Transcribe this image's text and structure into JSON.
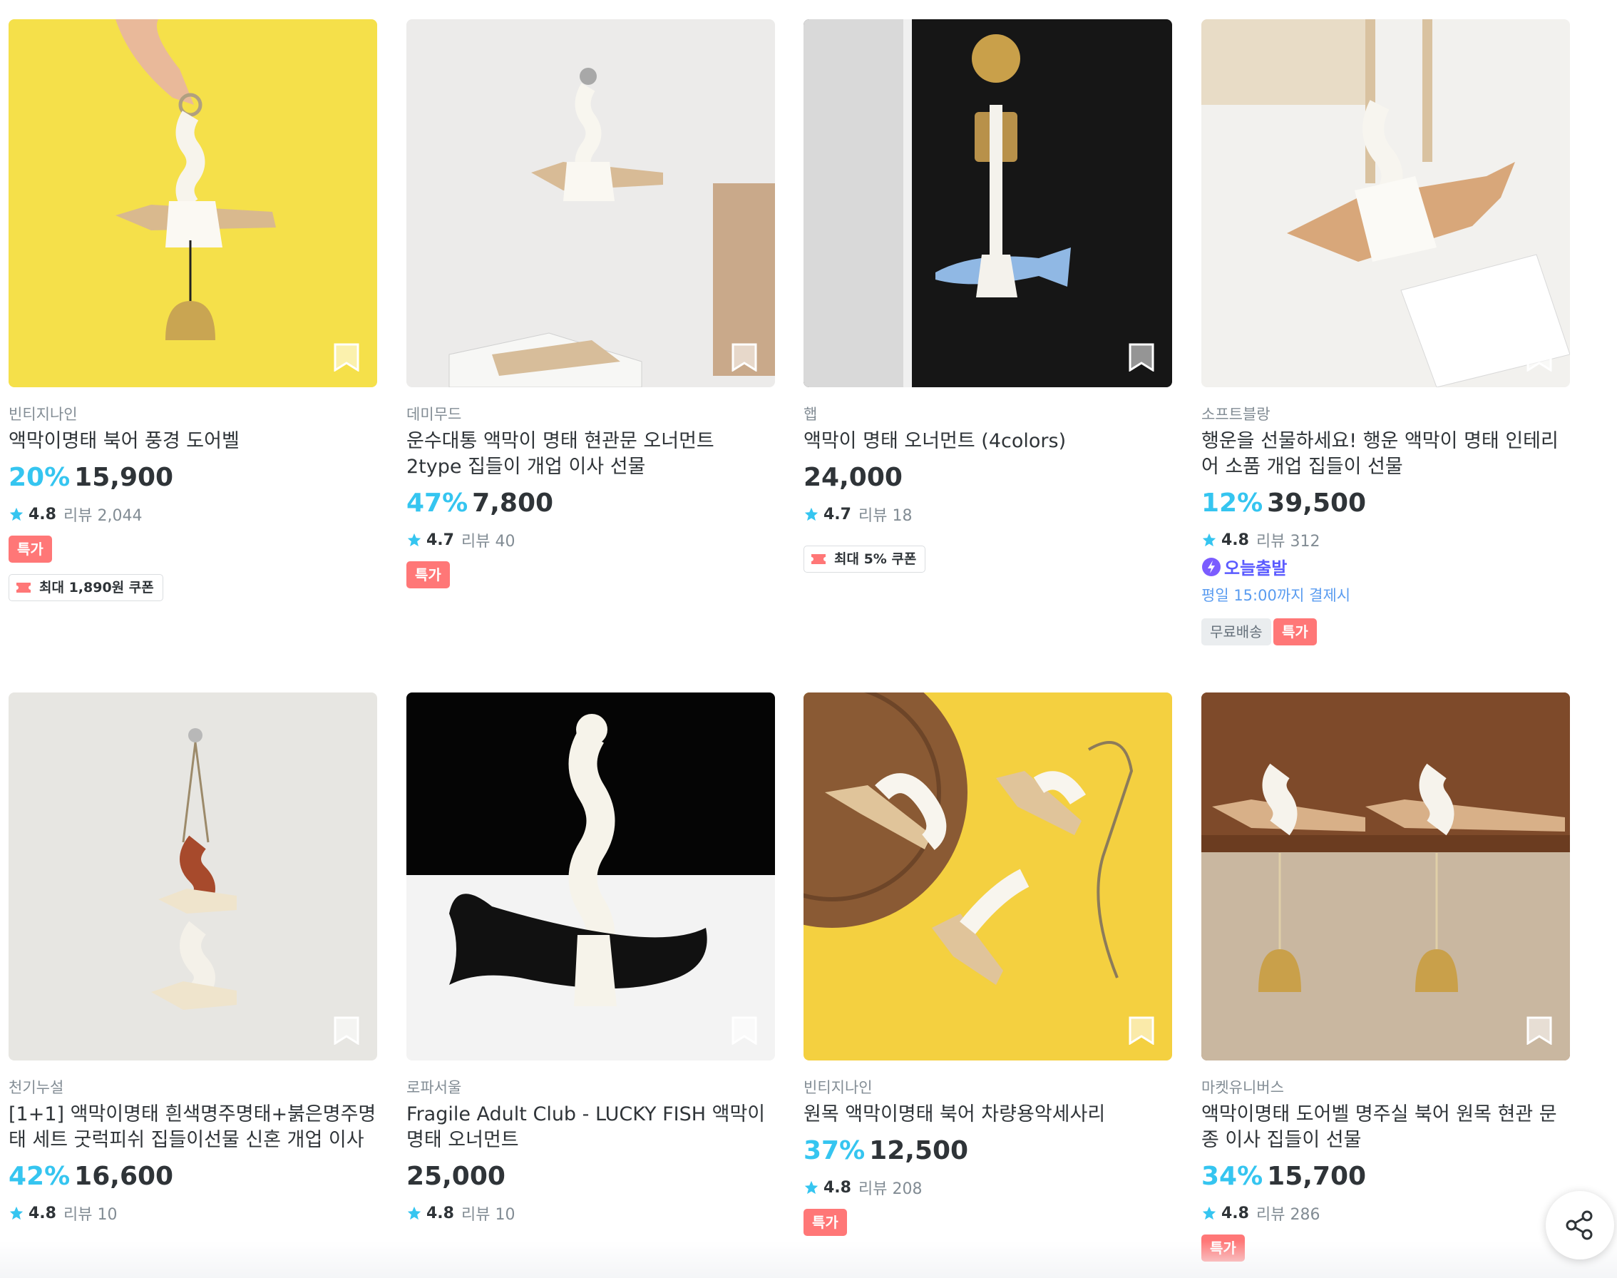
{
  "products": [
    {
      "brand": "빈티지나인",
      "title": "액막이명태 북어 풍경 도어벨",
      "discount": "20%",
      "price": "15,900",
      "rating": "4.8",
      "reviews": "리뷰 2,044",
      "badges": [
        "특가"
      ],
      "coupon": "최대 1,890원 쿠폰"
    },
    {
      "brand": "데미무드",
      "title": "운수대통 액막이 명태 현관문 오너먼트 2type 집들이 개업 이사 선물",
      "discount": "47%",
      "price": "7,800",
      "rating": "4.7",
      "reviews": "리뷰 40",
      "badges": [
        "특가"
      ]
    },
    {
      "brand": "햅",
      "title": "액막이 명태 오너먼트 (4colors)",
      "discount": "",
      "price": "24,000",
      "rating": "4.7",
      "reviews": "리뷰 18",
      "badges": [],
      "coupon": "최대 5% 쿠폰"
    },
    {
      "brand": "소프트블랑",
      "title": "행운을 선물하세요! 행운 액막이 명태 인테리어 소품 개업 집들이 선물",
      "discount": "12%",
      "price": "39,500",
      "rating": "4.8",
      "reviews": "리뷰 312",
      "today": "오늘출발",
      "today_note": "평일 15:00까지 결제시",
      "badges": [
        "무료배송",
        "특가"
      ]
    },
    {
      "brand": "천기누설",
      "title": "[1+1] 액막이명태 흰색명주명태+붉은명주명태 세트 굿럭피쉬 집들이선물 신혼 개업 이사",
      "discount": "42%",
      "price": "16,600",
      "rating": "4.8",
      "reviews": "리뷰 10",
      "badges": []
    },
    {
      "brand": "로파서울",
      "title": "Fragile Adult Club - LUCKY FISH 액막이 명태 오너먼트",
      "discount": "",
      "price": "25,000",
      "rating": "4.8",
      "reviews": "리뷰 10",
      "badges": []
    },
    {
      "brand": "빈티지나인",
      "title": "원목 액막이명태 북어 차량용악세사리",
      "discount": "37%",
      "price": "12,500",
      "rating": "4.8",
      "reviews": "리뷰 208",
      "badges": [
        "특가"
      ]
    },
    {
      "brand": "마켓유니버스",
      "title": "액막이명태 도어벨 명주실 북어 원목 현관 문 종 이사 집들이 선물",
      "discount": "34%",
      "price": "15,700",
      "rating": "4.8",
      "reviews": "리뷰 286",
      "badges": [
        "특가"
      ]
    }
  ],
  "colors": {
    "discount": "#35c5f0",
    "special_badge": "#ff7777",
    "today": "#5b5bff",
    "star": "#35c5f0"
  },
  "icons": {
    "bookmark": "bookmark-icon",
    "star": "star-icon",
    "share": "share-icon",
    "coupon": "coupon-icon",
    "today": "lightning-icon"
  }
}
